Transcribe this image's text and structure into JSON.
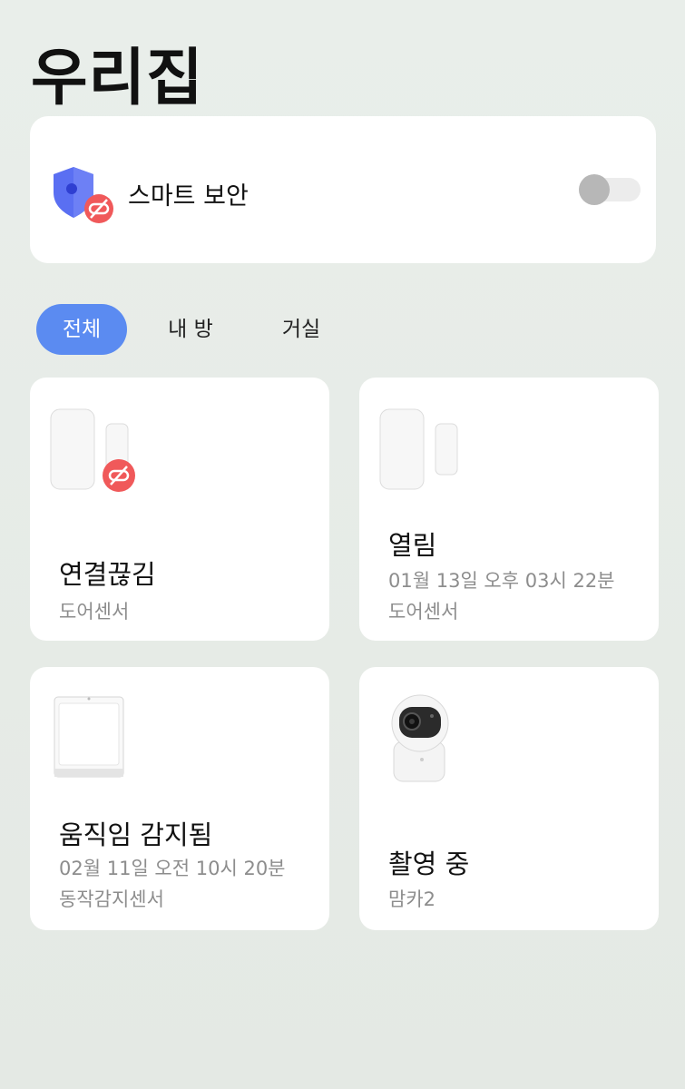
{
  "header": {
    "title": "우리집"
  },
  "security": {
    "label": "스마트 보안",
    "enabled": false
  },
  "tabs": [
    {
      "label": "전체",
      "active": true
    },
    {
      "label": "내 방",
      "active": false
    },
    {
      "label": "거실",
      "active": false
    }
  ],
  "devices": [
    {
      "status": "연결끊김",
      "time": "",
      "name": "도어센서",
      "icon": "door-sensor-icon",
      "offline": true
    },
    {
      "status": "열림",
      "time": "01월 13일 오후 03시 22분",
      "name": "도어센서",
      "icon": "door-sensor-icon",
      "offline": false
    },
    {
      "status": "움직임 감지됨",
      "time": "02월 11일 오전 10시 20분",
      "name": "동작감지센서",
      "icon": "motion-sensor-icon",
      "offline": false
    },
    {
      "status": "촬영 중",
      "time": "",
      "name": "맘카2",
      "icon": "camera-icon",
      "offline": false
    }
  ],
  "colors": {
    "accent": "#5b8bf1",
    "offline_badge": "#f0595a",
    "shield": "#5a6ff2"
  }
}
